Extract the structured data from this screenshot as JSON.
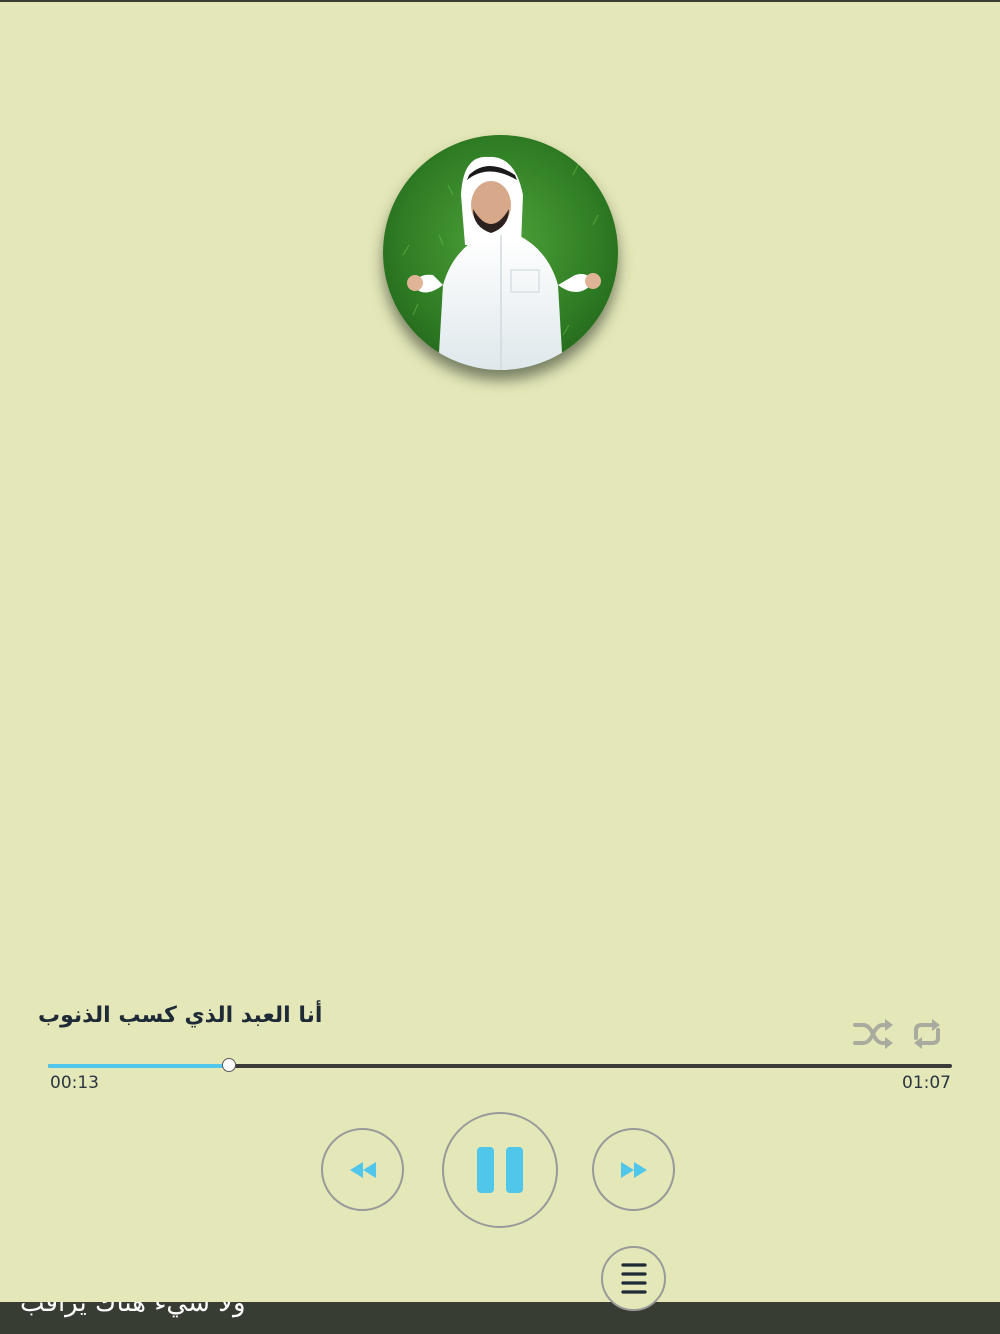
{
  "player": {
    "title": "أنا العبد الذي كسب الذنوب",
    "current_time": "00:13",
    "total_time": "01:07",
    "progress": 0.2,
    "accent_color": "#4fc6ea"
  },
  "artwork": {
    "icon": "reciter-portrait"
  },
  "controls": {
    "shuffle_icon": "shuffle-icon",
    "repeat_icon": "repeat-icon",
    "rewind_icon": "rewind-icon",
    "pause_icon": "pause-icon",
    "forward_icon": "fast-forward-icon",
    "playlist_icon": "list-icon"
  },
  "ticker": {
    "text": "ولا شيءٌ هناك يراقب"
  }
}
